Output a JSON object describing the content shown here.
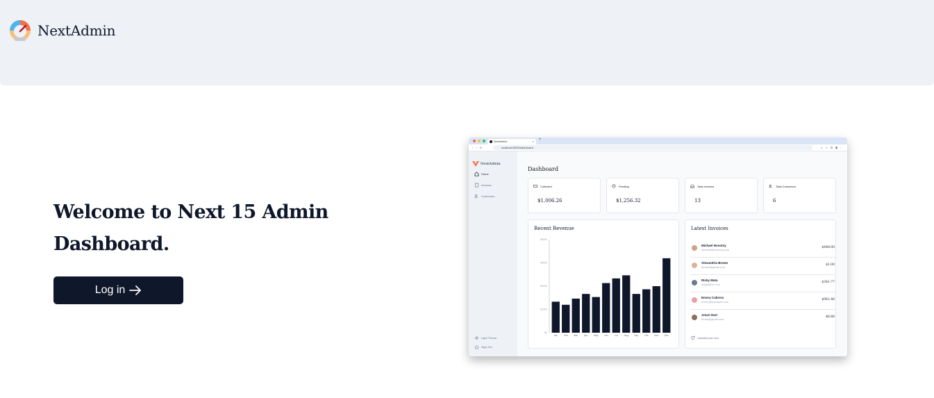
{
  "header": {
    "brand": "NextAdmin"
  },
  "hero": {
    "title": "Welcome to Next 15 Admin Dashboard.",
    "login_label": "Log in"
  },
  "preview": {
    "tab_title": "NextAdmin",
    "url": "localhost:3000/dashboard",
    "sidebar": {
      "brand": "NextAdmin",
      "items": [
        {
          "label": "Home",
          "icon": "home-icon"
        },
        {
          "label": "Invoices",
          "icon": "document-icon"
        },
        {
          "label": "Customers",
          "icon": "users-icon"
        }
      ],
      "footer": [
        {
          "label": "Light Theme",
          "icon": "sun-icon"
        },
        {
          "label": "Sign Out",
          "icon": "power-icon"
        }
      ]
    },
    "page_title": "Dashboard",
    "cards": [
      {
        "label": "Collected",
        "value": "$1,006.26",
        "icon": "banknote-icon"
      },
      {
        "label": "Pending",
        "value": "$1,256.32",
        "icon": "clock-icon"
      },
      {
        "label": "Total Invoices",
        "value": "13",
        "icon": "inbox-icon"
      },
      {
        "label": "Total Customers",
        "value": "6",
        "icon": "users-icon"
      }
    ],
    "revenue": {
      "title": "Recent Revenue",
      "chart_data": {
        "type": "bar",
        "categories": [
          "Jan",
          "Feb",
          "Mar",
          "Apr",
          "May",
          "Jun",
          "Jul",
          "Aug",
          "Sep",
          "Oct",
          "Nov",
          "Dec"
        ],
        "values": [
          2000,
          1800,
          2200,
          2500,
          2300,
          3200,
          3500,
          3700,
          2500,
          2800,
          3000,
          4800
        ],
        "yticks": [
          "$0",
          "$1000",
          "$2000",
          "$4000",
          "$5000"
        ],
        "ylim": [
          0,
          6000
        ],
        "bar_color": "#0f172a"
      }
    },
    "invoices": {
      "title": "Latest Invoices",
      "rows": [
        {
          "name": "Michael Novotny",
          "email": "michael@novotny.com",
          "amount": "$448.00",
          "avatar_color": "#c9a38a"
        },
        {
          "name": "Alexandria Brown",
          "email": "ibrown@gmail.com",
          "amount": "$1.00",
          "avatar_color": "#d8b4a0"
        },
        {
          "name": "Ricky Mata",
          "email": "ricky@live.com",
          "amount": "$341.77",
          "avatar_color": "#6b7b8c"
        },
        {
          "name": "Emery Cabrera",
          "email": "emery@example.com",
          "amount": "$942.46",
          "avatar_color": "#e8a0a8"
        },
        {
          "name": "Amari Hart",
          "email": "amari@gmail.com",
          "amount": "$6.66",
          "avatar_color": "#8a7060"
        }
      ],
      "updated": "Updated just now"
    }
  },
  "colors": {
    "primary": "#0f172a",
    "topbar_bg": "#eef1f6"
  }
}
